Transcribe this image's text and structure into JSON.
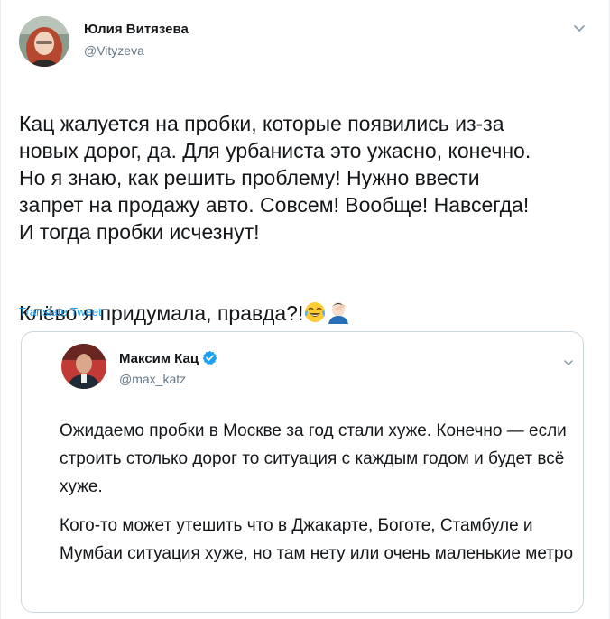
{
  "tweet": {
    "author_name": "Юлия Витязева",
    "author_handle": "@Vityzeva",
    "text_p1": "Кац жалуется на пробки, которые появились из-за\nновых дорог, да. Для урбаниста это ужасно, конечно.\nНо я знаю, как решить проблему! Нужно ввести\nзапрет на продажу авто. Совсем! Вообще! Навсегда!\nИ тогда пробки исчезнут!",
    "text_p2": "Клёво я придумала, правда?!",
    "translate_label": "Translate Tweet"
  },
  "quoted": {
    "author_name": "Максим Кац",
    "author_handle": "@max_katz",
    "paragraphs": [
      "Ожидаемо пробки в Москве за год стали хуже. Конечно — если строить столько дорог то ситуация с каждым годом и будет всё хуже.",
      "Кого-то может утешить что в Джакарте, Боготе, Стамбуле и Мумбаи ситуация хуже, но там нету или очень маленькие метро"
    ]
  },
  "icons": {
    "verified": "verified-badge-icon",
    "chevron": "chevron-down-icon",
    "emoji1": "face-with-tears-of-joy-emoji",
    "emoji2": "man-facepalming-emoji"
  },
  "colors": {
    "link": "#1da1f2",
    "secondary_text": "#657786",
    "border": "#ccd6dd"
  }
}
